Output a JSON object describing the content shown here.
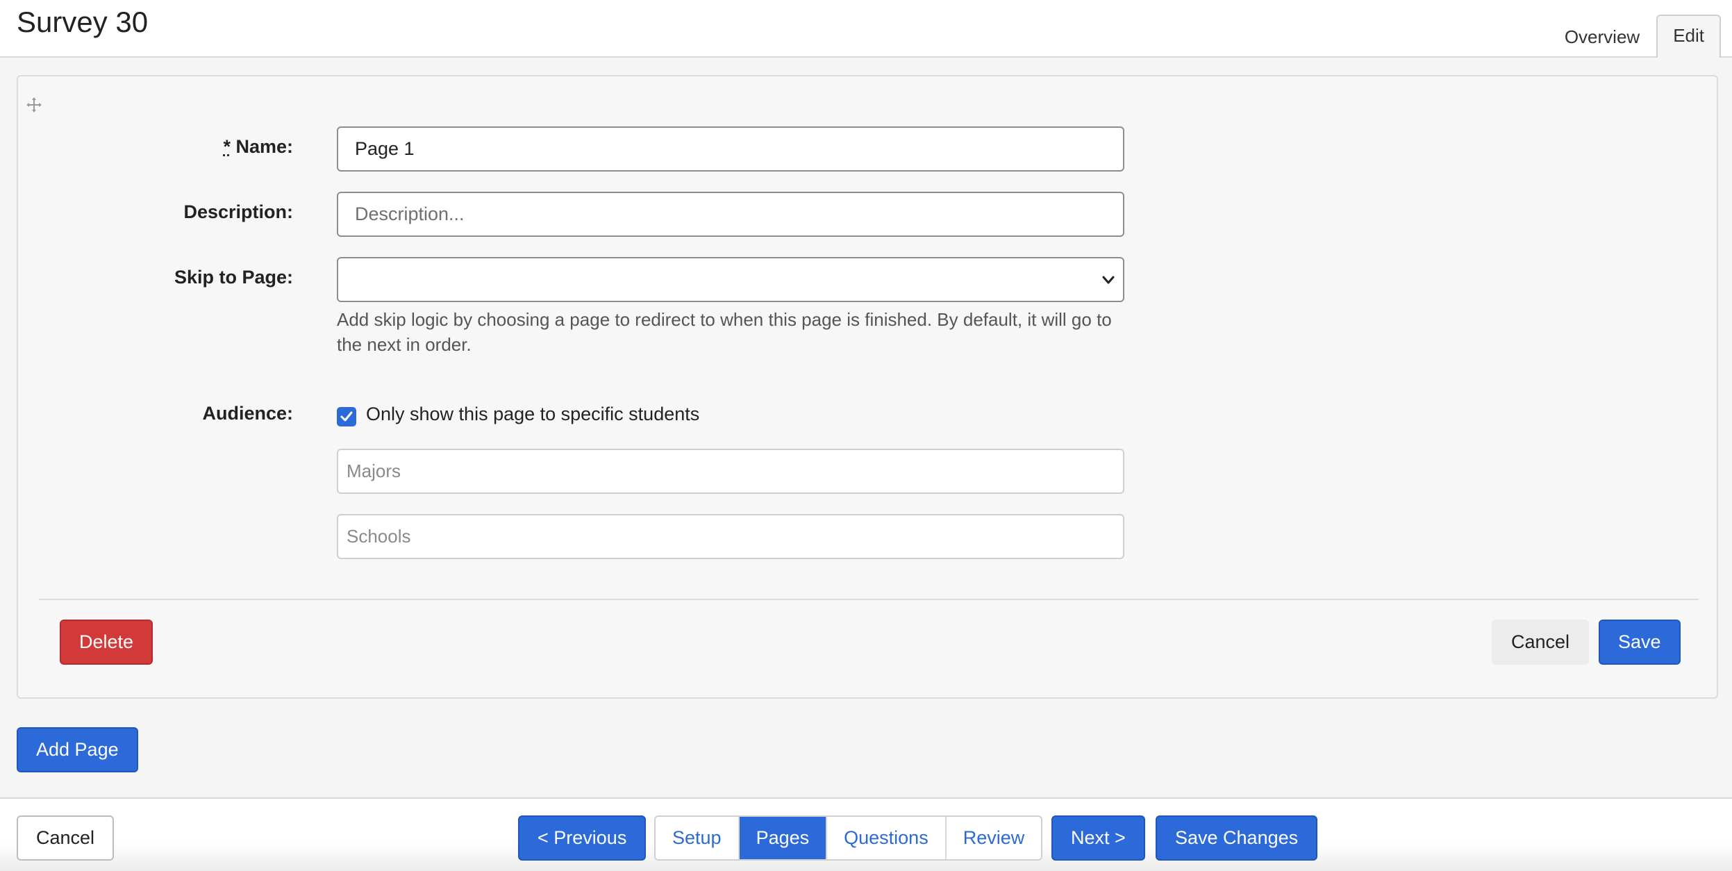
{
  "header": {
    "title": "Survey 30",
    "tabs": [
      {
        "label": "Overview",
        "active": false
      },
      {
        "label": "Edit",
        "active": true
      }
    ]
  },
  "form": {
    "name_label": "Name:",
    "name_required_mark": "*",
    "name_value": "Page 1",
    "description_label": "Description:",
    "description_placeholder": "Description...",
    "skip_label": "Skip to Page:",
    "skip_value": "",
    "skip_help": "Add skip logic by choosing a page to redirect to when this page is finished. By default, it will go to the next in order.",
    "audience_label": "Audience:",
    "audience_checkbox_label": "Only show this page to specific students",
    "audience_checked": true,
    "majors_placeholder": "Majors",
    "schools_placeholder": "Schools"
  },
  "panel_actions": {
    "delete_label": "Delete",
    "cancel_label": "Cancel",
    "save_label": "Save"
  },
  "add_page_label": "Add Page",
  "footer": {
    "cancel_label": "Cancel",
    "previous_label": "< Previous",
    "steps": [
      {
        "label": "Setup",
        "active": false
      },
      {
        "label": "Pages",
        "active": true
      },
      {
        "label": "Questions",
        "active": false
      },
      {
        "label": "Review",
        "active": false
      }
    ],
    "next_label": "Next >",
    "save_changes_label": "Save Changes"
  },
  "colors": {
    "primary": "#2b6ad8",
    "danger": "#d23a3a"
  },
  "icons": {
    "drag": "move-icon",
    "select": "chevron-down-icon",
    "checkbox": "checkmark-icon"
  }
}
